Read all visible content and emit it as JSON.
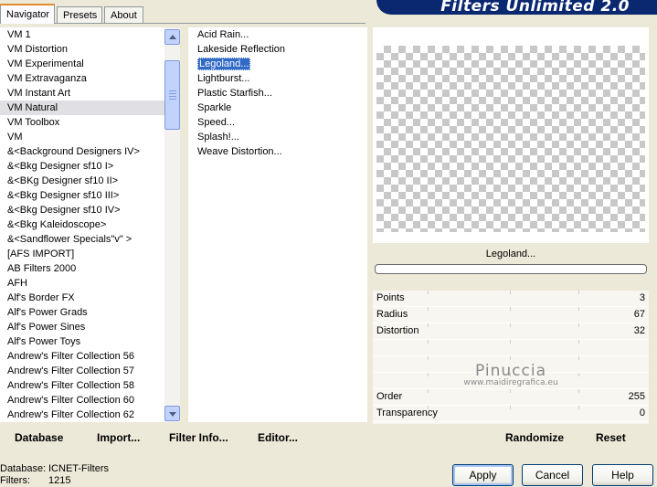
{
  "tabs": [
    "Navigator",
    "Presets",
    "About"
  ],
  "banner_title": "Filters Unlimited 2.0",
  "categories": [
    "VM 1",
    "VM Distortion",
    "VM Experimental",
    "VM Extravaganza",
    "VM Instant Art",
    "VM Natural",
    "VM Toolbox",
    "VM",
    "&<Background Designers IV>",
    "&<Bkg Designer sf10 I>",
    "&<BKg Designer sf10 II>",
    "&<Bkg Designer sf10 III>",
    "&<Bkg Designer sf10 IV>",
    "&<Bkg Kaleidoscope>",
    "&<Sandflower Specials\"v\" >",
    "[AFS IMPORT]",
    "AB Filters 2000",
    "AFH",
    "Alf's Border FX",
    "Alf's Power Grads",
    "Alf's Power Sines",
    "Alf's Power Toys",
    "Andrew's Filter Collection 56",
    "Andrew's Filter Collection 57",
    "Andrew's Filter Collection 58",
    "Andrew's Filter Collection 60",
    "Andrew's Filter Collection 62"
  ],
  "selected_category": "VM Natural",
  "filters": [
    "Acid Rain...",
    "Lakeside Reflection",
    "Legoland...",
    "Lightburst...",
    "Plastic Starfish...",
    "Sparkle",
    "Speed...",
    "Splash!...",
    "Weave Distortion..."
  ],
  "selected_filter": "Legoland...",
  "preview_filter_name": "Legoland...",
  "progress": 0,
  "params": [
    {
      "name": "Points",
      "value": "3"
    },
    {
      "name": "Radius",
      "value": "67"
    },
    {
      "name": "Distortion",
      "value": "32"
    },
    {
      "name": "",
      "value": ""
    },
    {
      "name": "",
      "value": ""
    },
    {
      "name": "",
      "value": ""
    },
    {
      "name": "Order",
      "value": "255"
    },
    {
      "name": "Transparency",
      "value": "0"
    }
  ],
  "watermark": {
    "line1": "Pinuccia",
    "line2": "www.maidiregrafica.eu"
  },
  "bottom_buttons": {
    "database": "Database",
    "import": "Import...",
    "filter_info": "Filter Info...",
    "editor": "Editor...",
    "randomize": "Randomize",
    "reset": "Reset"
  },
  "status": {
    "database_label": "Database:",
    "database_value": "ICNET-Filters",
    "filters_label": "Filters:",
    "filters_value": "1215"
  },
  "dialog_buttons": {
    "apply": "Apply",
    "cancel": "Cancel",
    "help": "Help"
  }
}
